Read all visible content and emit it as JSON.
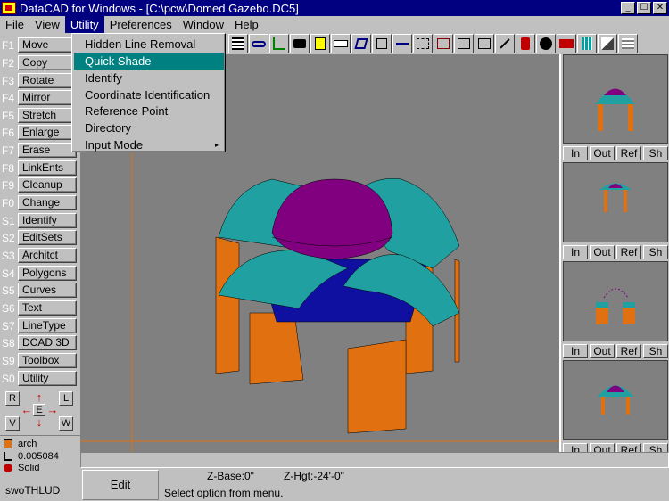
{
  "window": {
    "title": "DataCAD for Windows  - [C:\\pcw\\Domed Gazebo.DC5]",
    "min": "_",
    "max": "☐",
    "close": "✕"
  },
  "menubar": [
    "File",
    "View",
    "Utility",
    "Preferences",
    "Window",
    "Help"
  ],
  "utility_menu": {
    "items": [
      {
        "label": "Hidden Line Removal"
      },
      {
        "label": "Quick Shade",
        "selected": true
      },
      {
        "label": "Identify"
      },
      {
        "label": "Coordinate Identification"
      },
      {
        "label": "Reference Point"
      },
      {
        "label": "Directory"
      },
      {
        "label": "Input Mode",
        "submenu": "▸"
      }
    ]
  },
  "function_keys": [
    {
      "key": "F1",
      "label": "Move"
    },
    {
      "key": "F2",
      "label": "Copy"
    },
    {
      "key": "F3",
      "label": "Rotate"
    },
    {
      "key": "F4",
      "label": "Mirror"
    },
    {
      "key": "F5",
      "label": "Stretch"
    },
    {
      "key": "F6",
      "label": "Enlarge"
    },
    {
      "key": "F7",
      "label": "Erase"
    },
    {
      "key": "F8",
      "label": "LinkEnts"
    },
    {
      "key": "F9",
      "label": "Cleanup"
    },
    {
      "key": "F0",
      "label": "Change"
    },
    {
      "key": "S1",
      "label": "Identify"
    },
    {
      "key": "S2",
      "label": "EditSets"
    },
    {
      "key": "S3",
      "label": "Architct"
    },
    {
      "key": "S4",
      "label": "Polygons"
    },
    {
      "key": "S5",
      "label": "Curves"
    },
    {
      "key": "S6",
      "label": "Text"
    },
    {
      "key": "S7",
      "label": "LineType"
    },
    {
      "key": "S8",
      "label": "DCAD 3D"
    },
    {
      "key": "S9",
      "label": "Toolbox"
    },
    {
      "key": "S0",
      "label": "Utility"
    }
  ],
  "arrowpad": {
    "r": "R",
    "l": "L",
    "v": "V",
    "w": "W",
    "e": "E",
    "up": "↑",
    "down": "↓",
    "left": "←",
    "right": "→"
  },
  "layer_status": {
    "layer": "arch",
    "thickness": "0.005084",
    "fill": "Solid",
    "mode": "swoTHLUD",
    "layer_color": "#e07010",
    "fill_color": "#c00000"
  },
  "views": [
    {
      "in": "In",
      "out": "Out",
      "ref": "Ref",
      "sh": "Sh"
    },
    {
      "in": "In",
      "out": "Out",
      "ref": "Ref",
      "sh": "Sh"
    },
    {
      "in": "In",
      "out": "Out",
      "ref": "Ref",
      "sh": "Sh"
    },
    {
      "in": "In",
      "out": "Out",
      "ref": "Ref",
      "sh": "Sh"
    }
  ],
  "status": {
    "mode": "Edit",
    "zbase": "Z-Base:0\"",
    "zhgt": "Z-Hgt:-24'-0\"",
    "prompt": "Select option from menu."
  },
  "colors": {
    "dome": "#800080",
    "vault": "#20a0a0",
    "legs": "#e07010",
    "canvas": "#808080",
    "titlebar": "#000080",
    "menu_highlight": "#008080"
  }
}
